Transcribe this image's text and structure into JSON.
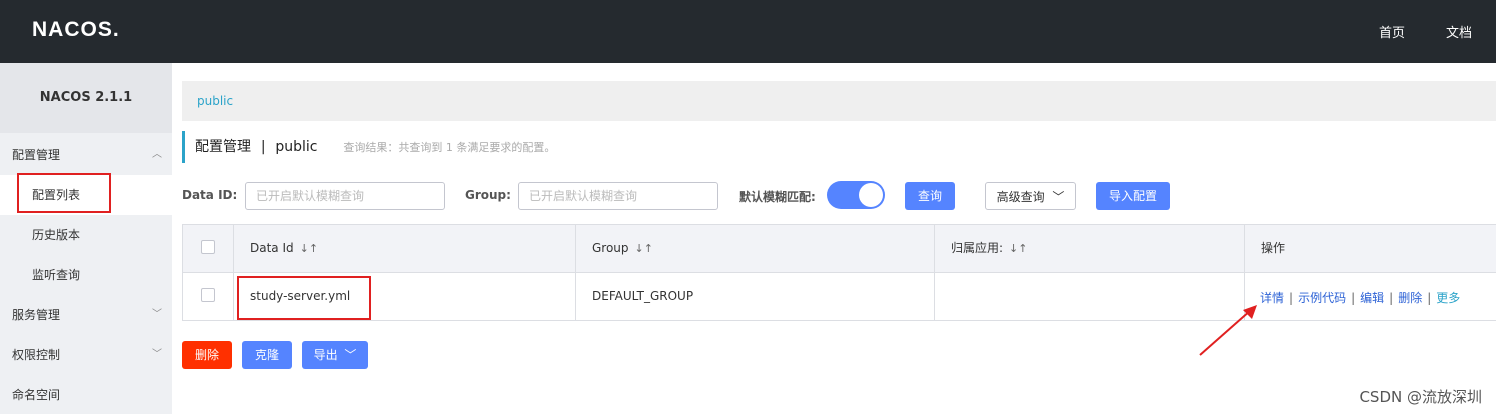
{
  "header": {
    "logo": "NACOS.",
    "nav": [
      "首页",
      "文档"
    ]
  },
  "sidebar": {
    "version": "NACOS 2.1.1",
    "groups": [
      {
        "label": "配置管理",
        "expanded": true,
        "items": [
          "配置列表",
          "历史版本",
          "监听查询"
        ]
      },
      {
        "label": "服务管理",
        "expanded": false
      },
      {
        "label": "权限控制",
        "expanded": false
      },
      {
        "label": "命名空间"
      }
    ]
  },
  "breadcrumb": "public",
  "title": {
    "main": "配置管理",
    "separator": "|",
    "namespace": "public",
    "hint": "查询结果：共查询到 1 条满足要求的配置。"
  },
  "search": {
    "data_id_label": "Data ID:",
    "data_id_placeholder": "已开启默认模糊查询",
    "group_label": "Group:",
    "group_placeholder": "已开启默认模糊查询",
    "fuzzy_label": "默认模糊匹配:",
    "fuzzy_enabled": true,
    "query_button": "查询",
    "advanced_button": "高级查询",
    "import_button": "导入配置"
  },
  "table": {
    "columns": [
      "Data Id",
      "Group",
      "归属应用:",
      "操作"
    ],
    "rows": [
      {
        "data_id": "study-server.yml",
        "group": "DEFAULT_GROUP",
        "app": "",
        "actions": [
          "详情",
          "示例代码",
          "编辑",
          "删除",
          "更多"
        ]
      }
    ]
  },
  "footer_buttons": {
    "delete": "删除",
    "clone": "克隆",
    "export": "导出"
  },
  "watermark": "CSDN @流放深圳",
  "colors": {
    "topbar": "#252a2f",
    "accent_blue": "#5584ff",
    "danger_red": "#ff3000",
    "highlight_box": "#e02020",
    "link_teal": "#2ba3c9"
  }
}
